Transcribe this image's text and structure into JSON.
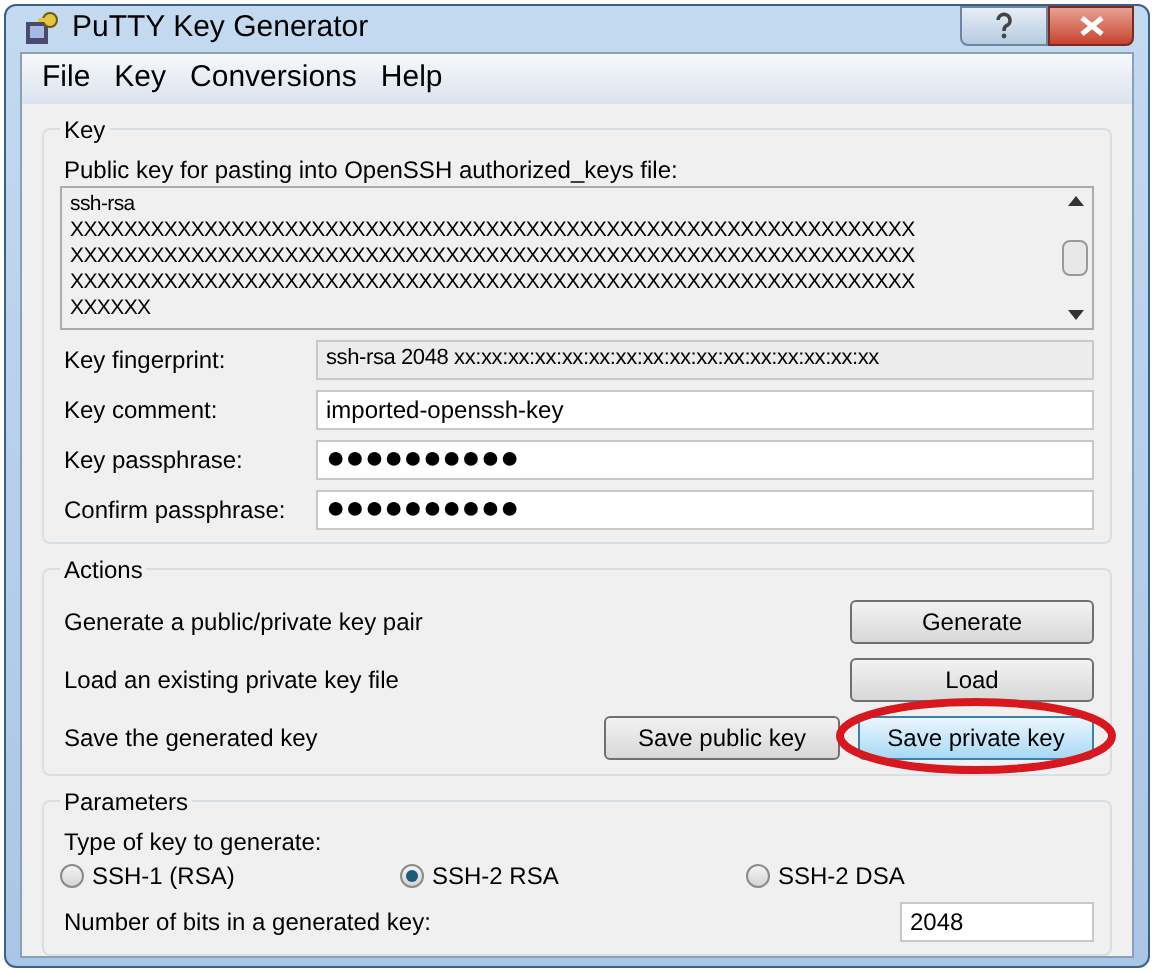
{
  "window": {
    "title": "PuTTY Key Generator"
  },
  "menu": [
    "File",
    "Key",
    "Conversions",
    "Help"
  ],
  "key_group": {
    "title": "Key",
    "public_key_label": "Public key for pasting into OpenSSH authorized_keys file:",
    "public_key_lines": [
      "ssh-rsa",
      "XXXXXXXXXXXXXXXXXXXXXXXXXXXXXXXXXXXXXXXXXXXXXXXXXXXXXXXXXXXXXXX",
      "XXXXXXXXXXXXXXXXXXXXXXXXXXXXXXXXXXXXXXXXXXXXXXXXXXXXXXXXXXXXXXX",
      "XXXXXXXXXXXXXXXXXXXXXXXXXXXXXXXXXXXXXXXXXXXXXXXXXXXXXXXXXXXXXXX",
      "XXXXXX"
    ],
    "fields": [
      {
        "label": "Key fingerprint:",
        "value": "ssh-rsa 2048 xx:xx:xx:xx:xx:xx:xx:xx:xx:xx:xx:xx:xx:xx:xx:xx",
        "kind": "readonly"
      },
      {
        "label": "Key comment:",
        "value": "imported-openssh-key",
        "kind": "text"
      },
      {
        "label": "Key passphrase:",
        "value": "●●●●●●●●●●",
        "kind": "password"
      },
      {
        "label": "Confirm passphrase:",
        "value": "●●●●●●●●●●",
        "kind": "password"
      }
    ]
  },
  "actions_group": {
    "title": "Actions",
    "rows": [
      {
        "label": "Generate a public/private key pair",
        "buttons": [
          {
            "label": "Generate",
            "highlighted": false
          }
        ]
      },
      {
        "label": "Load an existing private key file",
        "buttons": [
          {
            "label": "Load",
            "highlighted": false
          }
        ]
      },
      {
        "label": "Save the generated key",
        "buttons": [
          {
            "label": "Save public key",
            "highlighted": false
          },
          {
            "label": "Save private key",
            "highlighted": true
          }
        ]
      }
    ]
  },
  "parameters_group": {
    "title": "Parameters",
    "type_label": "Type of key to generate:",
    "key_types": [
      {
        "label": "SSH-1 (RSA)",
        "selected": false
      },
      {
        "label": "SSH-2 RSA",
        "selected": true
      },
      {
        "label": "SSH-2 DSA",
        "selected": false
      }
    ],
    "bits_label": "Number of bits in a generated key:",
    "bits_value": "2048"
  }
}
